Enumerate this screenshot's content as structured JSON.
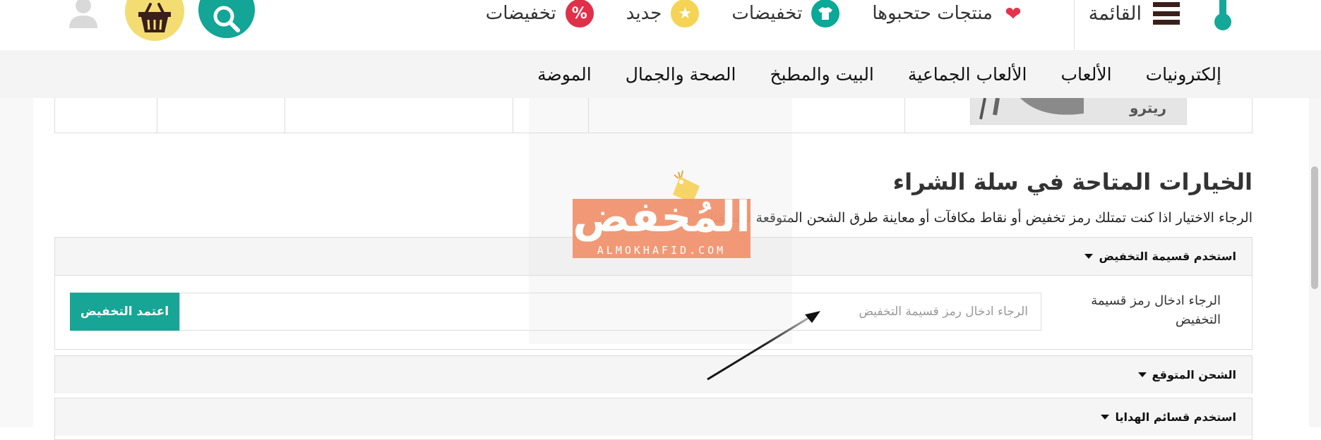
{
  "header": {
    "menu_label": "القائمة",
    "nav": [
      {
        "label": "منتجات حتحبوها",
        "icon": "heart-icon"
      },
      {
        "label": "تخفيضات",
        "icon": "shirt-icon"
      },
      {
        "label": "جديد",
        "icon": "star-icon"
      },
      {
        "label": "تخفيضات",
        "icon": "percent-icon"
      }
    ],
    "percent_symbol": "%",
    "colors": {
      "teal": "#13a596",
      "yellow": "#f3dd73",
      "red": "#e0304a",
      "heart": "#e4334b"
    }
  },
  "categories": [
    "إلكترونيات",
    "الألعاب",
    "الألعاب الجماعية",
    "البيت والمطبخ",
    "الصحة والجمال",
    "الموضة"
  ],
  "product_thumb_text": "ريترو",
  "cart_options": {
    "title": "الخيارات المتاحة في سلة الشراء",
    "subtitle": "الرجاء الاختيار اذا كنت تمتلك رمز تخفيض أو نقاط مكافآت أو معاينة طرق الشحن المتوقعة لمنطقتك",
    "coupon_panel": {
      "heading": "استخدم قسيمة التخفيض",
      "field_label": "الرجاء ادخال رمز قسيمة التخفيض",
      "input_placeholder": "الرجاء ادخال رمز قسيمة التخفيض",
      "input_value": "",
      "apply_label": "اعتمد التخفيض"
    },
    "shipping_panel": {
      "heading": "الشحن المتوقع"
    },
    "gift_panel": {
      "heading": "استخدم قسائم الهدايا"
    }
  },
  "watermark": {
    "text": "المُخفض",
    "subtext": "ALMOKHAFID.COM"
  }
}
